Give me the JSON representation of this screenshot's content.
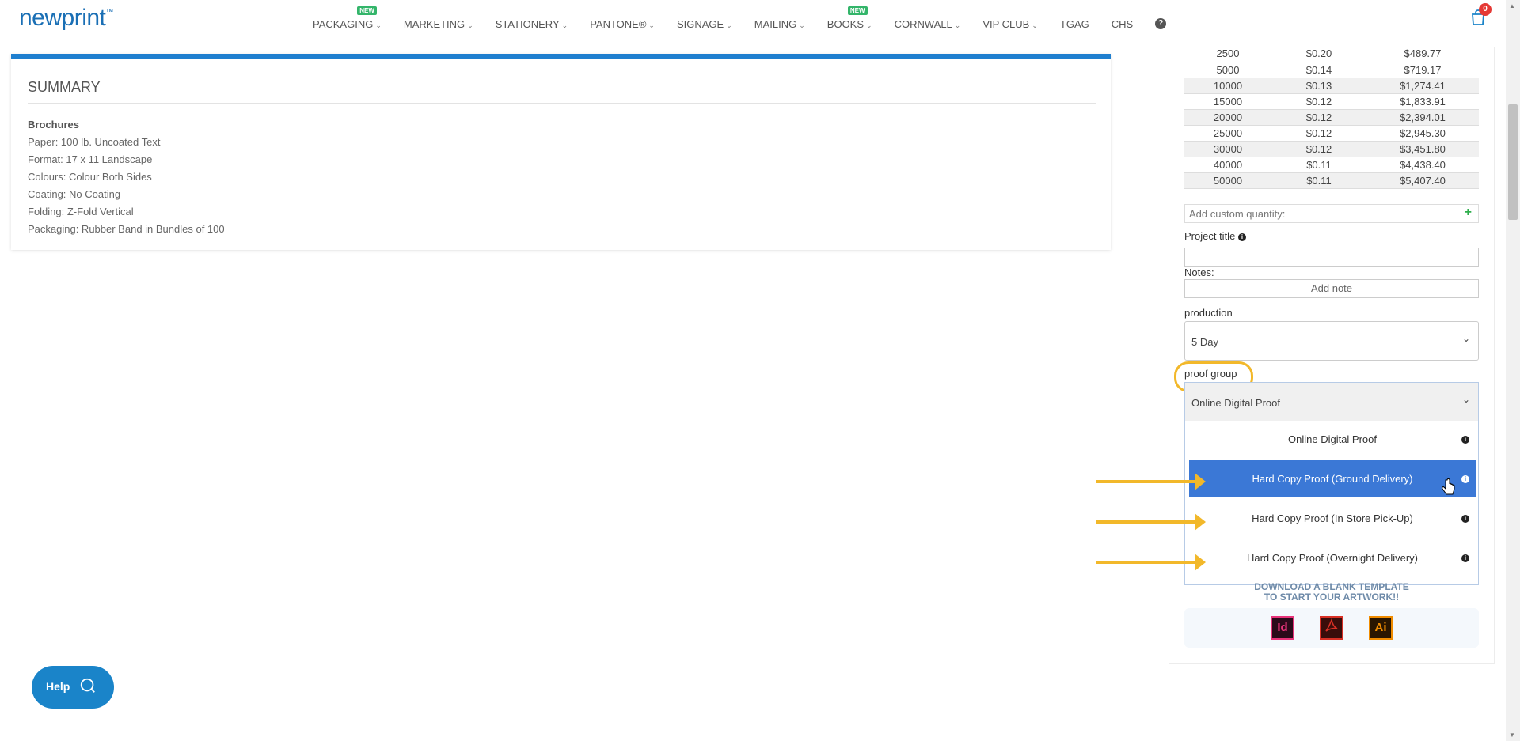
{
  "header": {
    "logo": "newprint",
    "logo_tm": "™",
    "nav": [
      {
        "label": "PACKAGING",
        "badge": "NEW"
      },
      {
        "label": "MARKETING"
      },
      {
        "label": "STATIONERY"
      },
      {
        "label": "PANTONE®"
      },
      {
        "label": "SIGNAGE"
      },
      {
        "label": "MAILING"
      },
      {
        "label": "BOOKS",
        "badge": "NEW"
      },
      {
        "label": "CORNWALL"
      },
      {
        "label": "VIP CLUB"
      },
      {
        "label": "TGAG"
      },
      {
        "label": "CHS"
      }
    ],
    "help_icon": "?",
    "cart_count": "0"
  },
  "summary": {
    "title": "SUMMARY",
    "product": "Brochures",
    "lines": [
      "Paper: 100 lb. Uncoated Text",
      "Format: 17 x 11 Landscape",
      "Colours: Colour Both Sides",
      "Coating: No Coating",
      "Folding: Z-Fold Vertical",
      "Packaging: Rubber Band in Bundles of 100"
    ]
  },
  "pricing": {
    "rows": [
      {
        "qty": "2500",
        "unit": "$0.20",
        "total": "$489.77"
      },
      {
        "qty": "5000",
        "unit": "$0.14",
        "total": "$719.17"
      },
      {
        "qty": "10000",
        "unit": "$0.13",
        "total": "$1,274.41"
      },
      {
        "qty": "15000",
        "unit": "$0.12",
        "total": "$1,833.91"
      },
      {
        "qty": "20000",
        "unit": "$0.12",
        "total": "$2,394.01"
      },
      {
        "qty": "25000",
        "unit": "$0.12",
        "total": "$2,945.30"
      },
      {
        "qty": "30000",
        "unit": "$0.12",
        "total": "$3,451.80"
      },
      {
        "qty": "40000",
        "unit": "$0.11",
        "total": "$4,438.40"
      },
      {
        "qty": "50000",
        "unit": "$0.11",
        "total": "$5,407.40"
      }
    ],
    "custom_qty_placeholder": "Add custom quantity:",
    "custom_qty_add": "+"
  },
  "form": {
    "project_title_label": "Project title",
    "notes_label": "Notes:",
    "add_note": "Add note",
    "production_label": "production",
    "production_value": "5 Day",
    "proof_group_label": "proof group",
    "proof_value": "Online Digital Proof",
    "proof_options": [
      "Online Digital Proof",
      "Hard Copy Proof (Ground Delivery)",
      "Hard Copy Proof (In Store Pick-Up)",
      "Hard Copy Proof (Overnight Delivery)"
    ],
    "proof_selected_index": 1
  },
  "download": {
    "line1": "DOWNLOAD A BLANK TEMPLATE",
    "line2": "TO START YOUR ARTWORK!!",
    "icons": [
      {
        "label": "Id",
        "icon": "indesign-icon",
        "color": "#e8337a"
      },
      {
        "label": "",
        "icon": "pdf-icon",
        "color": "#d93025"
      },
      {
        "label": "Ai",
        "icon": "illustrator-icon",
        "color": "#f08c00"
      }
    ]
  },
  "help": {
    "label": "Help"
  },
  "colors": {
    "accent": "#1f7fcf",
    "selected": "#3b78d6",
    "annotation": "#f2b82a"
  }
}
